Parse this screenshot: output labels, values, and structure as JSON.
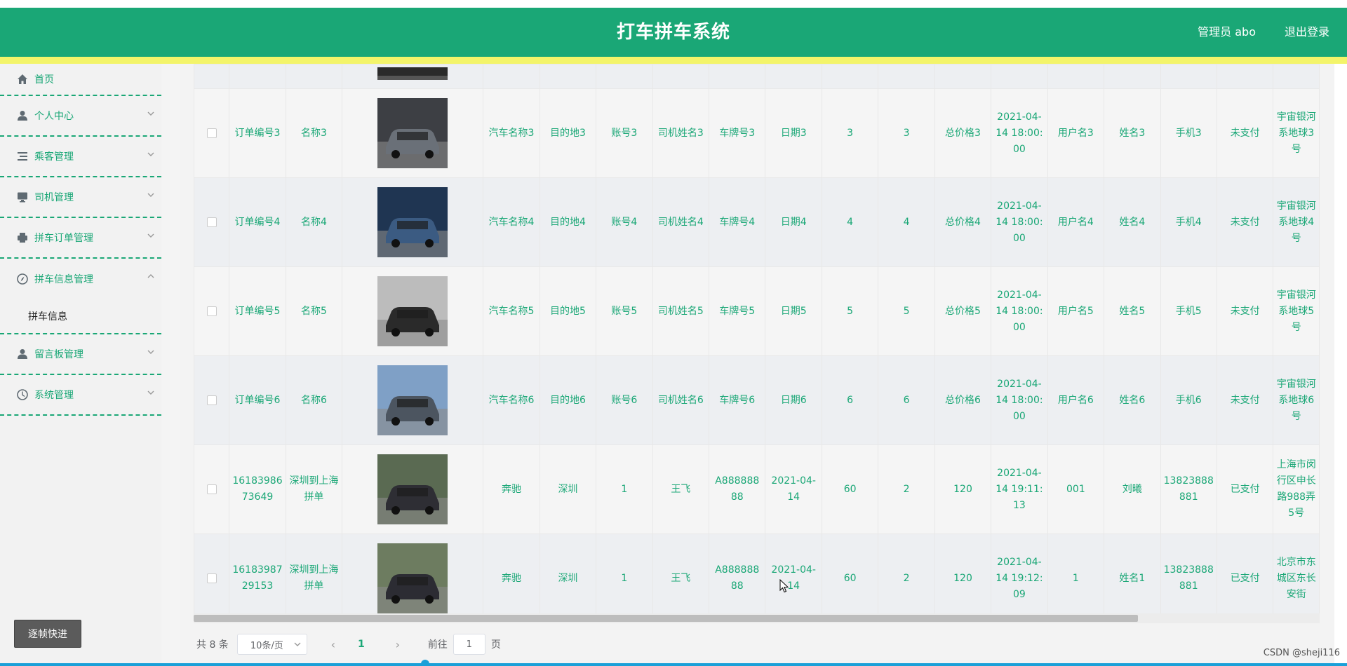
{
  "header": {
    "title": "打车拼车系统",
    "user_label": "管理员 abo",
    "logout_label": "退出登录"
  },
  "sidebar": {
    "items": [
      {
        "label": "首页",
        "icon": "home-icon"
      },
      {
        "label": "个人中心",
        "icon": "user-icon"
      },
      {
        "label": "乘客管理",
        "icon": "list-icon"
      },
      {
        "label": "司机管理",
        "icon": "monitor-icon"
      },
      {
        "label": "拼车订单管理",
        "icon": "printer-icon"
      },
      {
        "label": "拼车信息管理",
        "icon": "compass-icon"
      },
      {
        "label": "留言板管理",
        "icon": "user-icon"
      },
      {
        "label": "系统管理",
        "icon": "clock-icon"
      }
    ],
    "open_submenu": {
      "label": "拼车信息"
    },
    "fast_button": "逐帧快进"
  },
  "table": {
    "rows": [
      {
        "order_no": "订单编号3",
        "name": "名称3",
        "car_name": "汽车名称3",
        "destination": "目的地3",
        "account": "账号3",
        "driver_name": "司机姓名3",
        "plate": "车牌号3",
        "date": "日期3",
        "c1": "3",
        "c2": "3",
        "total_price": "总价格3",
        "datetime": "2021-04-14 18:00:00",
        "username": "用户名3",
        "real_name": "姓名3",
        "phone": "手机3",
        "pay_status": "未支付",
        "address": "宇宙银河系地球3号"
      },
      {
        "order_no": "订单编号4",
        "name": "名称4",
        "car_name": "汽车名称4",
        "destination": "目的地4",
        "account": "账号4",
        "driver_name": "司机姓名4",
        "plate": "车牌号4",
        "date": "日期4",
        "c1": "4",
        "c2": "4",
        "total_price": "总价格4",
        "datetime": "2021-04-14 18:00:00",
        "username": "用户名4",
        "real_name": "姓名4",
        "phone": "手机4",
        "pay_status": "未支付",
        "address": "宇宙银河系地球4号"
      },
      {
        "order_no": "订单编号5",
        "name": "名称5",
        "car_name": "汽车名称5",
        "destination": "目的地5",
        "account": "账号5",
        "driver_name": "司机姓名5",
        "plate": "车牌号5",
        "date": "日期5",
        "c1": "5",
        "c2": "5",
        "total_price": "总价格5",
        "datetime": "2021-04-14 18:00:00",
        "username": "用户名5",
        "real_name": "姓名5",
        "phone": "手机5",
        "pay_status": "未支付",
        "address": "宇宙银河系地球5号"
      },
      {
        "order_no": "订单编号6",
        "name": "名称6",
        "car_name": "汽车名称6",
        "destination": "目的地6",
        "account": "账号6",
        "driver_name": "司机姓名6",
        "plate": "车牌号6",
        "date": "日期6",
        "c1": "6",
        "c2": "6",
        "total_price": "总价格6",
        "datetime": "2021-04-14 18:00:00",
        "username": "用户名6",
        "real_name": "姓名6",
        "phone": "手机6",
        "pay_status": "未支付",
        "address": "宇宙银河系地球6号"
      },
      {
        "order_no": "1618398673649",
        "name": "深圳到上海拼单",
        "car_name": "奔驰",
        "destination": "深圳",
        "account": "1",
        "driver_name": "王飞",
        "plate": "A88888888",
        "date": "2021-04-14",
        "c1": "60",
        "c2": "2",
        "total_price": "120",
        "datetime": "2021-04-14 19:11:13",
        "username": "001",
        "real_name": "刘曦",
        "phone": "13823888881",
        "pay_status": "已支付",
        "address": "上海市闵行区申长路988弄5号"
      },
      {
        "order_no": "1618398729153",
        "name": "深圳到上海拼单",
        "car_name": "奔驰",
        "destination": "深圳",
        "account": "1",
        "driver_name": "王飞",
        "plate": "A88888888",
        "date": "2021-04-14",
        "c1": "60",
        "c2": "2",
        "total_price": "120",
        "datetime": "2021-04-14 19:12:09",
        "username": "1",
        "real_name": "姓名1",
        "phone": "13823888881",
        "pay_status": "已支付",
        "address": "北京市东城区东长安街"
      }
    ]
  },
  "pager": {
    "total": "共 8 条",
    "page_size": "10条/页",
    "current_page": "1",
    "goto_label": "前往",
    "goto_value": "1",
    "page_suffix": "页"
  },
  "watermark": "CSDN @sheji116"
}
